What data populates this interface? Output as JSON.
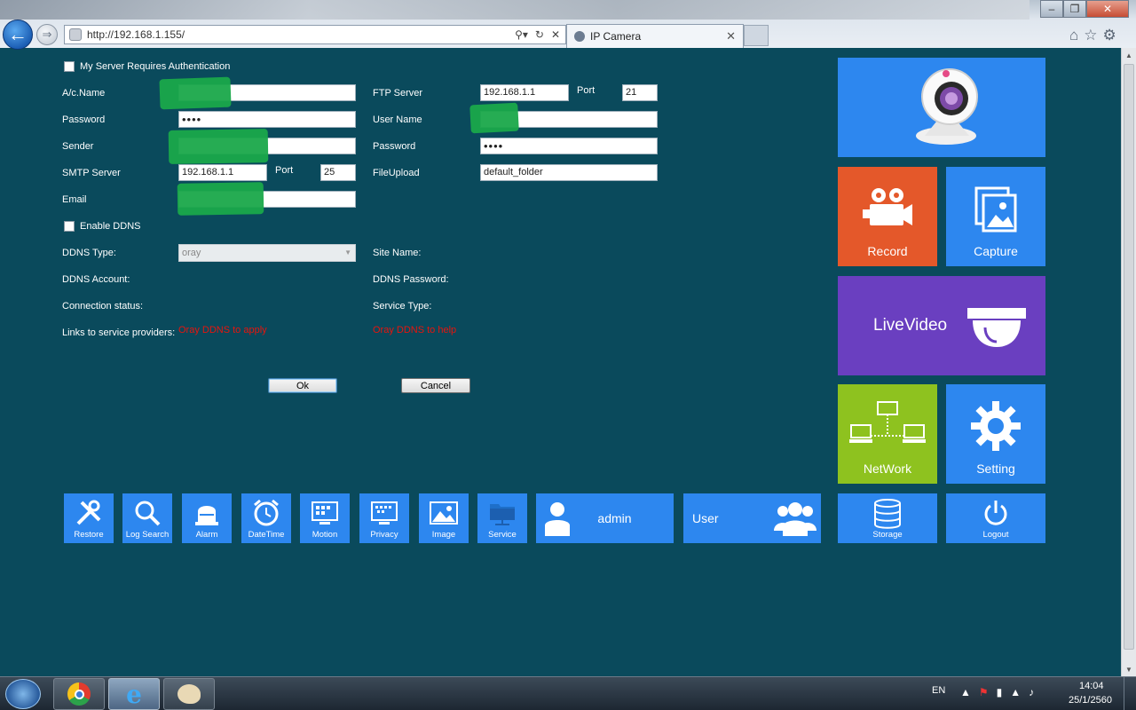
{
  "browser": {
    "url": "http://192.168.1.155/",
    "tab_title": "IP Camera",
    "back_icon": "back-arrow-icon",
    "forward_icon": "forward-arrow-icon"
  },
  "smtp": {
    "auth_label": "My Server Requires Authentication",
    "account_label": "A/c.Name",
    "password_label": "Password",
    "password_value": "••••",
    "sender_label": "Sender",
    "smtp_server_label": "SMTP Server",
    "smtp_server_value": "192.168.1.1",
    "port_label": "Port",
    "port_value": "25",
    "email_label": "Email"
  },
  "ftp": {
    "server_label": "FTP Server",
    "server_value": "192.168.1.1",
    "port_label": "Port",
    "port_value": "21",
    "username_label": "User Name",
    "password_label": "Password",
    "password_value": "••••",
    "upload_label": "FileUpload",
    "upload_value": "default_folder"
  },
  "ddns": {
    "enable_label": "Enable DDNS",
    "type_label": "DDNS Type:",
    "type_value": "oray",
    "site_label": "Site Name:",
    "account_label": "DDNS Account:",
    "password_label": "DDNS Password:",
    "status_label": "Connection status:",
    "service_type_label": "Service Type:",
    "links_label": "Links to service providers:",
    "link_apply": "Oray DDNS to apply",
    "link_help": "Oray DDNS to help"
  },
  "buttons": {
    "ok": "Ok",
    "cancel": "Cancel"
  },
  "tiles": {
    "record": "Record",
    "capture": "Capture",
    "livevideo": "LiveVideo",
    "network": "NetWork",
    "setting": "Setting",
    "storage": "Storage",
    "logout": "Logout"
  },
  "toolbar": {
    "restore": "Restore",
    "log_search": "Log Search",
    "alarm": "Alarm",
    "datetime": "DateTime",
    "motion": "Motion",
    "privacy": "Privacy",
    "image": "Image",
    "service": "Service",
    "admin": "admin",
    "user": "User"
  },
  "taskbar": {
    "lang": "EN",
    "time": "14:04",
    "date": "25/1/2560"
  },
  "colors": {
    "background": "#0a4a5c",
    "tile_blue": "#2d87ef",
    "tile_orange": "#e4582a",
    "tile_purple": "#6a3fc0",
    "tile_green": "#8ec21f",
    "link_red": "#e8140d"
  }
}
